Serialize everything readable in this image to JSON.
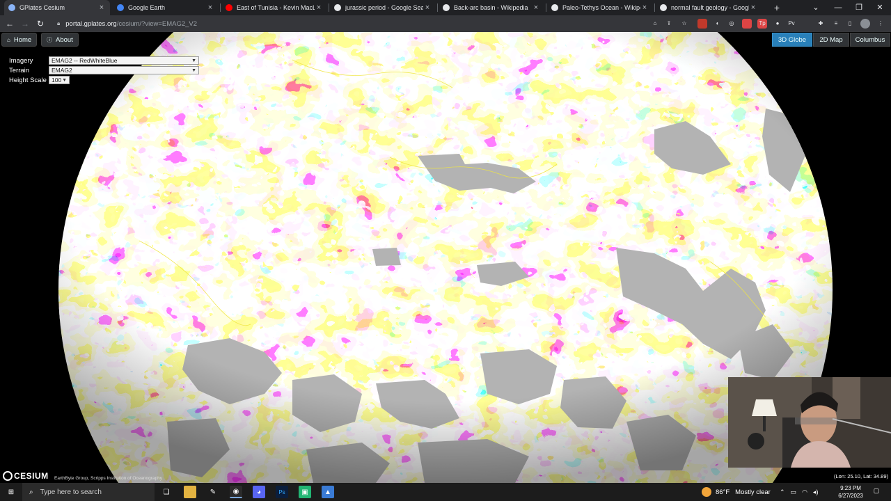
{
  "browser": {
    "tabs": [
      {
        "title": "GPlates Cesium",
        "favicon": "globe-icon",
        "color": "#8ab4f8",
        "active": true
      },
      {
        "title": "Google Earth",
        "favicon": "google-earth-icon",
        "color": "#4285f4",
        "active": false
      },
      {
        "title": "East of Tunisia - Kevin MacLeod",
        "favicon": "youtube-icon",
        "color": "#ff0000",
        "active": false
      },
      {
        "title": "jurassic period - Google Search",
        "favicon": "google-icon",
        "color": "#e8eaed",
        "active": false
      },
      {
        "title": "Back-arc basin - Wikipedia",
        "favicon": "wikipedia-icon",
        "color": "#e8eaed",
        "active": false
      },
      {
        "title": "Paleo-Tethys Ocean - Wikipedia",
        "favicon": "wikipedia-icon",
        "color": "#e8eaed",
        "active": false
      },
      {
        "title": "normal fault geology - Google S",
        "favicon": "google-icon",
        "color": "#e8eaed",
        "active": false
      }
    ],
    "new_tab": "+",
    "url_host": "portal.gplates.org",
    "url_path": "/cesium/?view=EMAG2_V2"
  },
  "map": {
    "home_label": "Home",
    "about_label": "About",
    "modes": [
      {
        "label": "3D Globe",
        "active": true
      },
      {
        "label": "2D Map",
        "active": false
      },
      {
        "label": "Columbus",
        "active": false
      }
    ],
    "layers": {
      "imagery_label": "Imagery",
      "imagery_value": "EMAG2 -- RedWhiteBlue",
      "terrain_label": "Terrain",
      "terrain_value": "EMAG2",
      "height_label": "Height Scale",
      "height_value": "100"
    },
    "logo_text": "CESIUM",
    "credits": "EarthByte Group, Scripps Institution of Oceanography",
    "coordinates": "(Lon: 25.10,   Lat: 34.89)"
  },
  "taskbar": {
    "search_placeholder": "Type here to search",
    "weather_temp": "86°F",
    "weather_text": "Mostly clear",
    "time": "9:23 PM",
    "date": "6/27/2023"
  }
}
